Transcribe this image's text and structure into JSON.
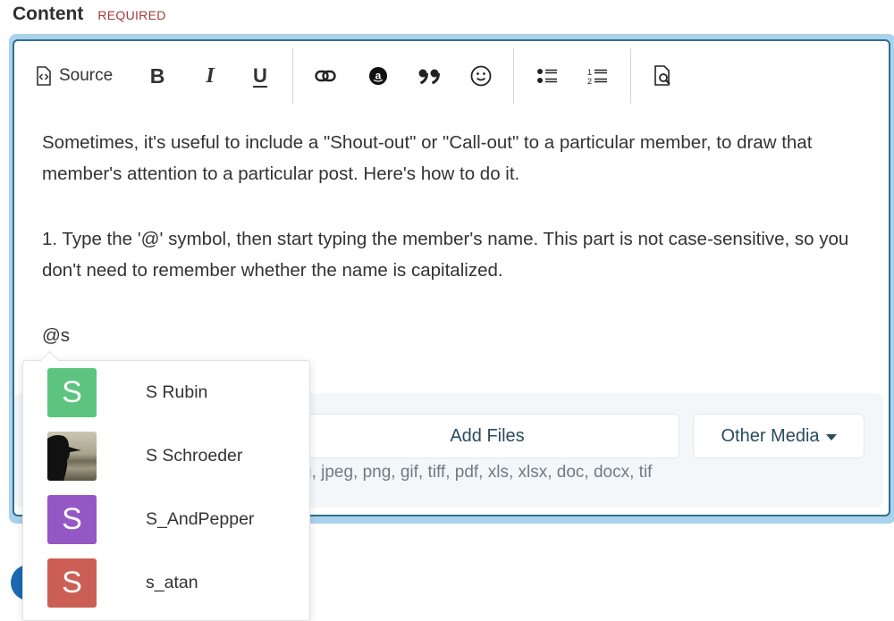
{
  "field": {
    "label": "Content",
    "required": "REQUIRED"
  },
  "toolbar": {
    "source_label": "Source",
    "bold_label": "B",
    "italic_label": "I",
    "underline_label": "U",
    "icons": [
      "source-icon",
      "bold-icon",
      "italic-icon",
      "underline-icon",
      "link-icon",
      "amazon-icon",
      "quote-icon",
      "emoji-icon",
      "bullet-list-icon",
      "numbered-list-icon",
      "preview-icon"
    ]
  },
  "editor": {
    "paragraphs": [
      "Sometimes, it's useful to include a \"Shout-out\" or \"Call-out\" to a particular member, to draw that member's attention to a particular post. Here's how to do it.",
      "1. Type the '@' symbol, then start typing the member's name. This part is not case-sensitive, so you don't need to remember whether the name is capitalized.",
      "@s"
    ]
  },
  "attachments": {
    "add_files_label": "Add Files",
    "other_media_label": "Other Media",
    "allowed_types_visible": "g, jpeg, png, gif, tiff, pdf, xls, xlsx, doc, docx, tif"
  },
  "mention_suggestions": [
    {
      "name": "S Rubin",
      "initial": "S",
      "avatar_color": "#5cc47f",
      "avatar_type": "letter"
    },
    {
      "name": "S Schroeder",
      "initial": "",
      "avatar_color": "#3b3a30",
      "avatar_type": "photo"
    },
    {
      "name": "S_AndPepper",
      "initial": "S",
      "avatar_color": "#9457c4",
      "avatar_type": "letter"
    },
    {
      "name": "s_atan",
      "initial": "S",
      "avatar_color": "#cc5f55",
      "avatar_type": "letter"
    }
  ],
  "colors": {
    "accent_border": "#2e6f8e",
    "focus_ring": "#a9d2ec",
    "required": "#a33a3a"
  }
}
